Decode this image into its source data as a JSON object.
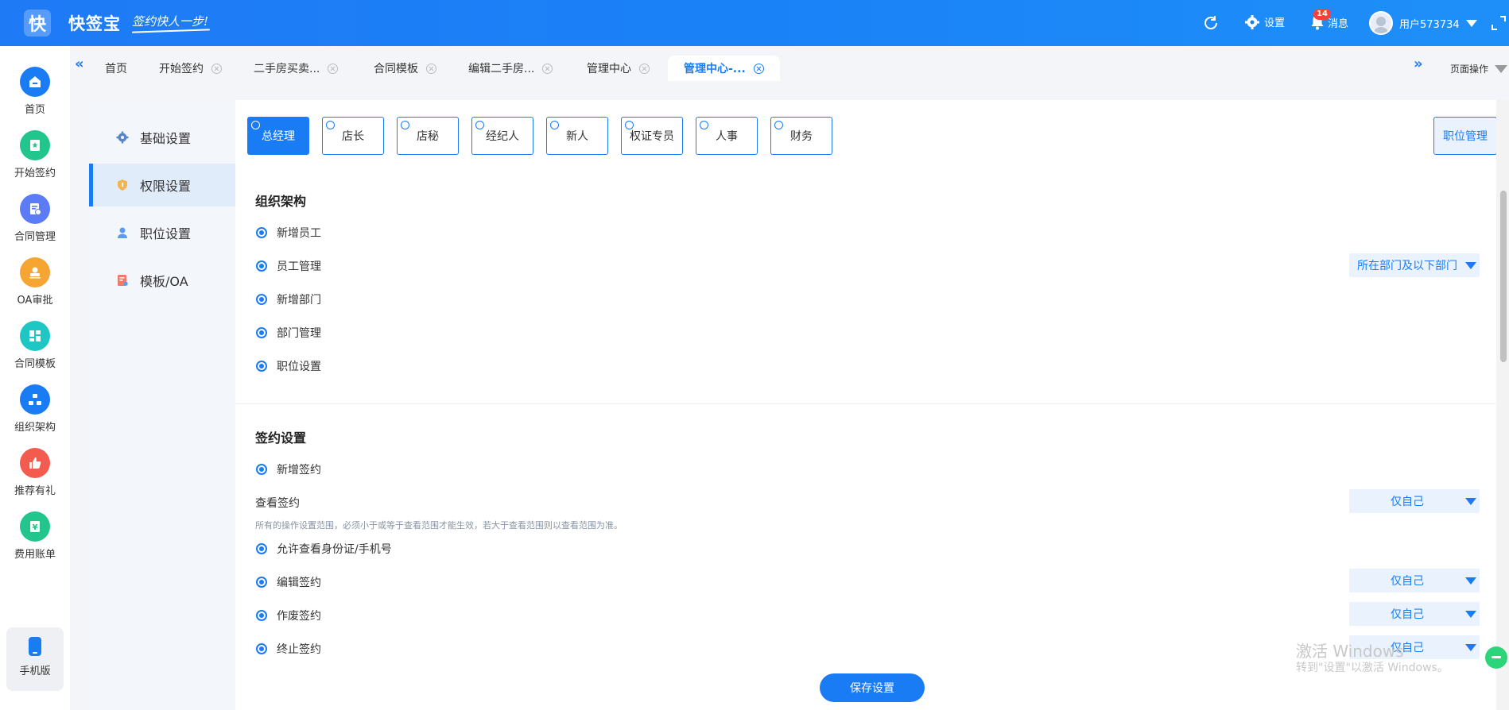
{
  "app": {
    "logo_char": "快",
    "name": "快签宝",
    "slogan": "签约快人一步!"
  },
  "header": {
    "settings_label": "设置",
    "messages_label": "消息",
    "message_count": "14",
    "user_name": "用户573734"
  },
  "leftnav": {
    "items": [
      {
        "label": "首页",
        "icon": "home-icon",
        "color": "#1a7cf5"
      },
      {
        "label": "开始签约",
        "icon": "sign-icon",
        "color": "#22c58b"
      },
      {
        "label": "合同管理",
        "icon": "contract-icon",
        "color": "#5b7cf6"
      },
      {
        "label": "OA审批",
        "icon": "stamp-icon",
        "color": "#f7a532"
      },
      {
        "label": "合同模板",
        "icon": "template-icon",
        "color": "#1fc7c4"
      },
      {
        "label": "组织架构",
        "icon": "org-icon",
        "color": "#1a7cf5"
      },
      {
        "label": "推荐有礼",
        "icon": "thumb-icon",
        "color": "#f35b4f"
      },
      {
        "label": "费用账单",
        "icon": "bill-icon",
        "color": "#22c58b"
      }
    ],
    "mobile_label": "手机版"
  },
  "tabs": {
    "items": [
      {
        "label": "首页",
        "closable": false
      },
      {
        "label": "开始签约",
        "closable": true
      },
      {
        "label": "二手房买卖...",
        "closable": true
      },
      {
        "label": "合同模板",
        "closable": true
      },
      {
        "label": "编辑二手房...",
        "closable": true
      },
      {
        "label": "管理中心",
        "closable": true
      },
      {
        "label": "管理中心-...",
        "closable": true,
        "active": true
      }
    ],
    "page_ops_label": "页面操作"
  },
  "submenu": {
    "items": [
      {
        "label": "基础设置",
        "icon": "gear-icon",
        "color": "#5a86c9"
      },
      {
        "label": "权限设置",
        "icon": "shield-icon",
        "color": "#f2b552",
        "active": true
      },
      {
        "label": "职位设置",
        "icon": "user-icon",
        "color": "#5a9bf2"
      },
      {
        "label": "模板/OA",
        "icon": "document-icon",
        "color": "#ee7a6c"
      }
    ]
  },
  "roles": {
    "items": [
      "总经理",
      "店长",
      "店秘",
      "经纪人",
      "新人",
      "权证专员",
      "人事",
      "财务"
    ],
    "active_index": 0,
    "manage_label": "职位管理"
  },
  "org_section": {
    "title": "组织架构",
    "items": [
      "新增员工",
      "员工管理",
      "新增部门",
      "部门管理",
      "职位设置"
    ],
    "staff_scope": "所在部门及以下部门"
  },
  "sign_section": {
    "title": "签约设置",
    "add_sign": "新增签约",
    "view_sign": "查看签约",
    "view_scope": "仅自己",
    "hint": "所有的操作设置范围，必须小于或等于查看范围才能生效，若大于查看范围则以查看范围为准。",
    "allow_id": "允许查看身份证/手机号",
    "edit_sign": "编辑签约",
    "edit_scope": "仅自己",
    "void_sign": "作废签约",
    "void_scope": "仅自己",
    "terminate_sign": "终止签约",
    "terminate_scope": "仅自己"
  },
  "save_label": "保存设置",
  "watermark": {
    "line1": "激活 Windows",
    "line2": "转到\"设置\"以激活 Windows。"
  }
}
